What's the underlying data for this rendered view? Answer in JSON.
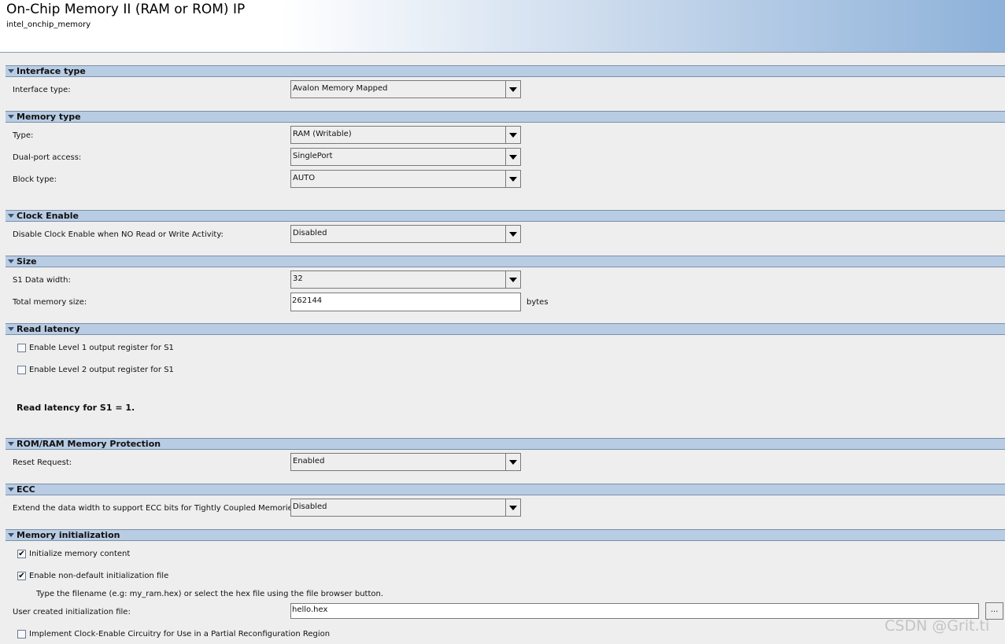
{
  "header": {
    "title": "On-Chip Memory II (RAM or ROM) IP",
    "subtitle": "intel_onchip_memory"
  },
  "sections": {
    "interface": {
      "title": "Interface type",
      "interface_type": {
        "label": "Interface type:",
        "value": "Avalon Memory Mapped"
      }
    },
    "memory_type": {
      "title": "Memory type",
      "type": {
        "label": "Type:",
        "value": "RAM (Writable)"
      },
      "dual_port": {
        "label": "Dual-port access:",
        "value": "SinglePort"
      },
      "block_type": {
        "label": "Block type:",
        "value": "AUTO"
      }
    },
    "clock_enable": {
      "title": "Clock Enable",
      "disable_clock": {
        "label": "Disable Clock Enable when NO Read or Write Activity:",
        "value": "Disabled"
      }
    },
    "size": {
      "title": "Size",
      "data_width": {
        "label": "S1 Data width:",
        "value": "32"
      },
      "total_size": {
        "label": "Total memory size:",
        "value": "262144",
        "unit": "bytes"
      }
    },
    "read_latency": {
      "title": "Read latency",
      "level1": {
        "label": "Enable Level 1 output register for S1",
        "checked": false
      },
      "level2": {
        "label": "Enable Level 2 output register for S1",
        "checked": false
      },
      "note": "Read latency for S1 = 1."
    },
    "protection": {
      "title": "ROM/RAM Memory Protection",
      "reset_request": {
        "label": "Reset Request:",
        "value": "Enabled"
      }
    },
    "ecc": {
      "title": "ECC",
      "extend_width": {
        "label": "Extend the data width to support ECC bits for Tightly Coupled Memories:",
        "value": "Disabled"
      }
    },
    "memory_init": {
      "title": "Memory initialization",
      "init_content": {
        "label": "Initialize memory content",
        "checked": true,
        "mark": "✔"
      },
      "non_default": {
        "label": "Enable non-default initialization file",
        "checked": true,
        "mark": "✔"
      },
      "hint": "Type the filename (e.g: my_ram.hex) or select the hex file using the file browser button.",
      "user_file": {
        "label": "User created initialization file:",
        "value": "hello.hex",
        "browse_label": "..."
      },
      "clock_enable_circuitry": {
        "label": "Implement Clock-Enable Circuitry for Use in a Partial Reconfiguration Region",
        "checked": false
      }
    }
  },
  "watermark": "CSDN @Grit.ti"
}
